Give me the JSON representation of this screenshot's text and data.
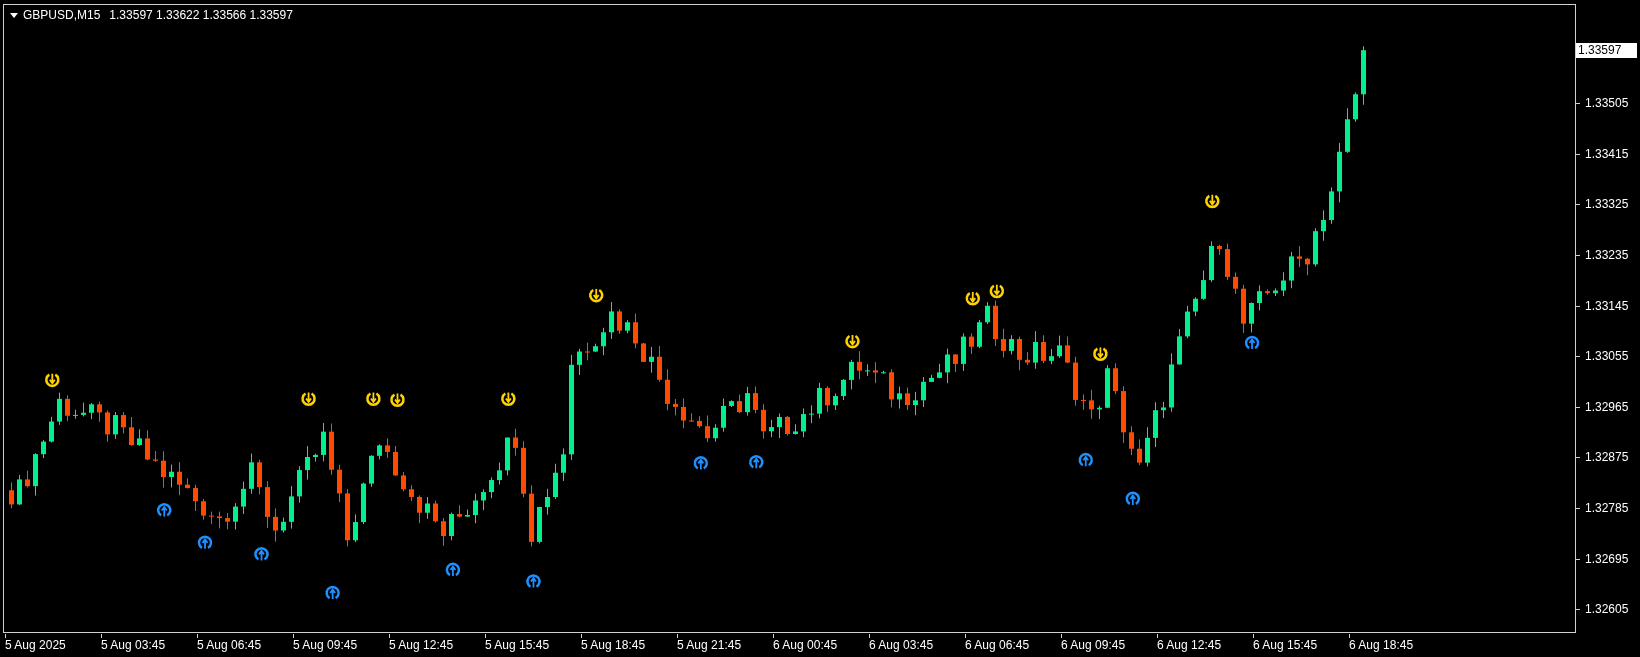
{
  "chart_header": {
    "symbol": "GBPUSD,M15",
    "quote": "1.33597 1.33622 1.33566 1.33597"
  },
  "current_price": "1.33597",
  "price_axis": [
    "1.33505",
    "1.33415",
    "1.33325",
    "1.33235",
    "1.33145",
    "1.33055",
    "1.32965",
    "1.32875",
    "1.32785",
    "1.32695",
    "1.32605"
  ],
  "time_axis": [
    "5 Aug 2025",
    "5 Aug 03:45",
    "5 Aug 06:45",
    "5 Aug 09:45",
    "5 Aug 12:45",
    "5 Aug 15:45",
    "5 Aug 18:45",
    "5 Aug 21:45",
    "6 Aug 00:45",
    "6 Aug 03:45",
    "6 Aug 06:45",
    "6 Aug 09:45",
    "6 Aug 12:45",
    "6 Aug 15:45",
    "6 Aug 18:45"
  ]
}
